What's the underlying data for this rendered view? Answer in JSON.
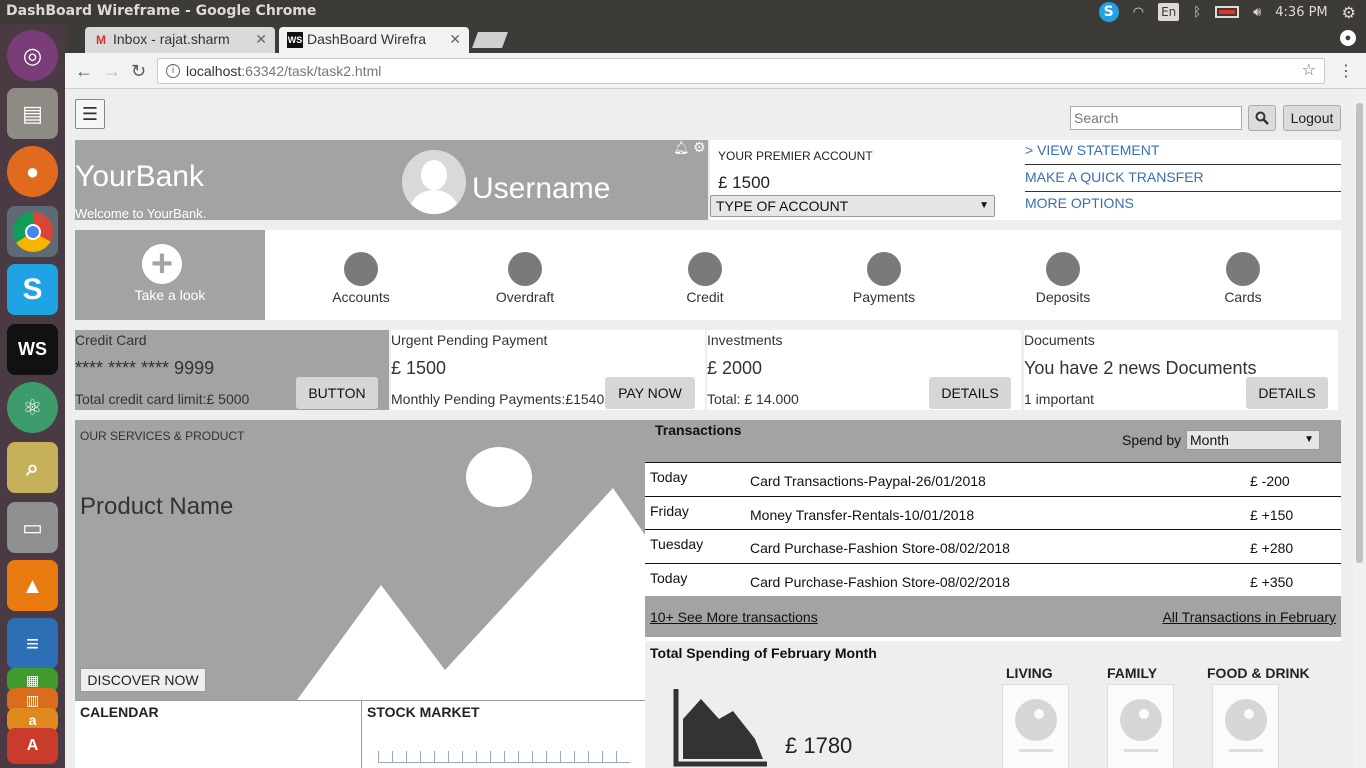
{
  "os": {
    "window_title": "DashBoard Wireframe - Google Chrome",
    "lang": "En",
    "clock": "4:36 PM"
  },
  "browser": {
    "tabs": [
      {
        "label": "Inbox - rajat.sharm",
        "icon": "gmail-icon"
      },
      {
        "label": "DashBoard Wirefra",
        "icon": "webstorm-icon"
      }
    ],
    "url_host": "localhost",
    "url_path": ":63342/task/task2.html"
  },
  "header": {
    "search_placeholder": "Search",
    "logout_label": "Logout"
  },
  "brand": {
    "name": "YourBank",
    "welcome": "Welcome to YourBank.",
    "username": "Username"
  },
  "account": {
    "title": "YOUR PREMIER ACCOUNT",
    "balance": "£ 1500",
    "type_select": "TYPE OF ACCOUNT"
  },
  "quick_links": [
    "> VIEW STATEMENT",
    "MAKE A QUICK TRANSFER",
    "MORE OPTIONS"
  ],
  "nav": {
    "take_look": "Take a look",
    "items": [
      "Accounts",
      "Overdraft",
      "Credit",
      "Payments",
      "Deposits",
      "Cards"
    ]
  },
  "cards": {
    "credit": {
      "title": "Credit Card",
      "value": "**** **** **** 9999",
      "note": "Total credit card limit:£ 5000",
      "button": "BUTTON"
    },
    "urgent": {
      "title": "Urgent Pending Payment",
      "value": "£ 1500",
      "note": "Monthly Pending Payments:£1540",
      "button": "PAY NOW"
    },
    "investments": {
      "title": "Investments",
      "value": "£ 2000",
      "note": "Total: £ 14.000",
      "button": "DETAILS"
    },
    "documents": {
      "title": "Documents",
      "value": "You have 2 news Documents",
      "note": "1 important",
      "button": "DETAILS"
    }
  },
  "product": {
    "label": "OUR SERVICES & PRODUCT",
    "name": "Product Name",
    "discover": "DISCOVER NOW"
  },
  "calendar": {
    "title": "CALENDAR"
  },
  "stock": {
    "title": "STOCK MARKET"
  },
  "transactions": {
    "title": "Transactions",
    "spend_by": "Spend by",
    "spend_select": "Month",
    "rows": [
      {
        "day": "Today",
        "desc": "Card Transactions-Paypal-26/01/2018",
        "amount": "£ -200"
      },
      {
        "day": "Friday",
        "desc": "Money Transfer-Rentals-10/01/2018",
        "amount": "£ +150"
      },
      {
        "day": "Tuesday",
        "desc": "Card Purchase-Fashion Store-08/02/2018",
        "amount": "£ +280"
      },
      {
        "day": "Today",
        "desc": "Card Purchase-Fashion Store-08/02/2018",
        "amount": "£ +350"
      }
    ],
    "see_more": "10+ See More transactions",
    "all_feb": "All Transactions in February"
  },
  "spending": {
    "title": "Total Spending of February Month",
    "total": "£ 1780",
    "categories": [
      "LIVING",
      "FAMILY",
      "FOOD & DRINK"
    ]
  }
}
